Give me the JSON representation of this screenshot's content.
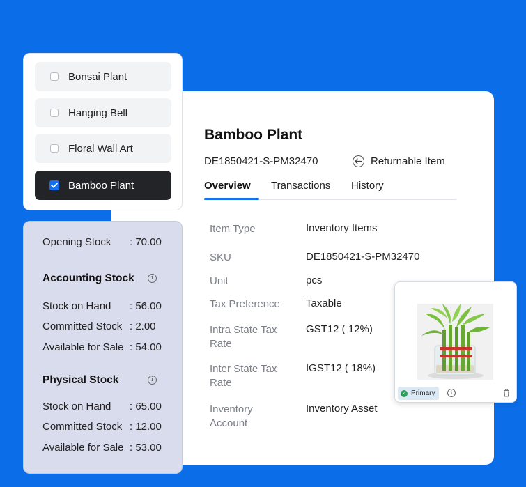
{
  "item_list": {
    "items": [
      {
        "label": "Bonsai Plant",
        "checked": false
      },
      {
        "label": "Hanging Bell",
        "checked": false
      },
      {
        "label": "Floral Wall Art",
        "checked": false
      },
      {
        "label": "Bamboo Plant",
        "checked": true
      }
    ]
  },
  "stock": {
    "opening_label": "Opening Stock",
    "opening_value": ": 70.00",
    "accounting": {
      "title": "Accounting Stock",
      "rows": [
        {
          "label": "Stock on Hand",
          "value": ": 56.00"
        },
        {
          "label": "Committed Stock",
          "value": ": 2.00"
        },
        {
          "label": "Available for Sale",
          "value": ": 54.00"
        }
      ]
    },
    "physical": {
      "title": "Physical Stock",
      "rows": [
        {
          "label": "Stock on Hand",
          "value": ": 65.00"
        },
        {
          "label": "Committed Stock",
          "value": ": 12.00"
        },
        {
          "label": "Available for Sale",
          "value": ": 53.00"
        }
      ]
    }
  },
  "detail": {
    "title": "Bamboo Plant",
    "sku": "DE1850421-S-PM32470",
    "returnable": "Returnable Item",
    "tabs": [
      "Overview",
      "Transactions",
      "History"
    ],
    "fields": [
      {
        "label": "Item Type",
        "value": "Inventory Items"
      },
      {
        "label": "SKU",
        "value": "DE1850421-S-PM32470"
      },
      {
        "label": "Unit",
        "value": "pcs"
      },
      {
        "label": "Tax Preference",
        "value": "Taxable"
      },
      {
        "label": "Intra State Tax Rate",
        "value": "GST12 ( 12%)"
      },
      {
        "label": "Inter State Tax Rate",
        "value": "IGST12 ( 18%)"
      },
      {
        "label": "Inventory Account",
        "value": "Inventory Asset"
      }
    ]
  },
  "image_card": {
    "badge": "Primary"
  },
  "colors": {
    "background": "#0b6ee8",
    "accent": "#1570ef",
    "selected_item": "#232427",
    "stock_panel": "#d8dcec"
  }
}
